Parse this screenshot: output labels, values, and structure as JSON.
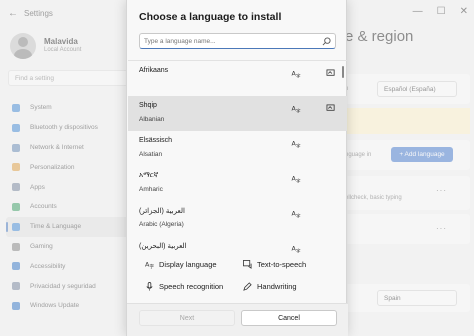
{
  "app": {
    "title": "Settings",
    "user_name": "Malavida",
    "user_sub": "Local Account",
    "find_placeholder": "Find a setting"
  },
  "nav": [
    {
      "label": "System",
      "icon": "system-icon",
      "color": "#4a8fd6"
    },
    {
      "label": "Bluetooth y dispositivos",
      "icon": "bluetooth-icon",
      "color": "#4a8fd6"
    },
    {
      "label": "Network & Internet",
      "icon": "network-icon",
      "color": "#6b8fb8"
    },
    {
      "label": "Personalization",
      "icon": "brush-icon",
      "color": "#e0a34b"
    },
    {
      "label": "Apps",
      "icon": "apps-icon",
      "color": "#7d8aa1"
    },
    {
      "label": "Accounts",
      "icon": "accounts-icon",
      "color": "#43a36b"
    },
    {
      "label": "Time & Language",
      "icon": "time-language-icon",
      "color": "#4a8fd6",
      "active": true
    },
    {
      "label": "Gaming",
      "icon": "gaming-icon",
      "color": "#8a8a8a"
    },
    {
      "label": "Accessibility",
      "icon": "accessibility-icon",
      "color": "#3f7ec9"
    },
    {
      "label": "Privacidad y seguridad",
      "icon": "shield-icon",
      "color": "#7d8aa1"
    },
    {
      "label": "Windows Update",
      "icon": "update-icon",
      "color": "#3f7ec9"
    }
  ],
  "page": {
    "heading_fragment": "e & region",
    "display_language_value": "Español (España)",
    "language_hint": "nguage in",
    "add_language_label": "+ Add language",
    "typing_hint": "ellcheck, basic typing",
    "region_value": "Spain"
  },
  "dialog": {
    "title": "Choose a language to install",
    "search_placeholder": "Type a language name...",
    "languages": [
      {
        "name": "Afrikaans",
        "sub": ""
      },
      {
        "name": "Shqip",
        "sub": "Albanian",
        "selected": true
      },
      {
        "name": "Elsässisch",
        "sub": "Alsatian"
      },
      {
        "name": "አማርኛ",
        "sub": "Amharic"
      },
      {
        "name": "العربية (الجزائر)",
        "sub": "Arabic (Algeria)"
      },
      {
        "name": "العربية (البحرين)",
        "sub": "Arabic (Bahrain)"
      }
    ],
    "features": {
      "display_language": "Display language",
      "text_to_speech": "Text-to-speech",
      "speech_recognition": "Speech recognition",
      "handwriting": "Handwriting"
    },
    "next_label": "Next",
    "cancel_label": "Cancel"
  },
  "colors": {
    "accent": "#4b78b9",
    "add_button": "#4c7fd1",
    "warning_strip": "#fff4ce"
  }
}
